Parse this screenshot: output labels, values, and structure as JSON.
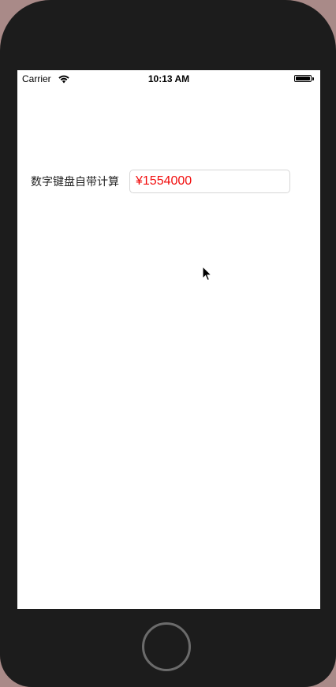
{
  "status_bar": {
    "carrier": "Carrier",
    "time": "10:13 AM",
    "wifi_icon": "wifi-icon",
    "battery_icon": "battery-icon"
  },
  "form": {
    "label": "数字键盘自带计算",
    "input_value": "¥1554000",
    "input_color": "#f20d0d"
  },
  "device": {
    "home_button_icon": "home-button-icon"
  }
}
